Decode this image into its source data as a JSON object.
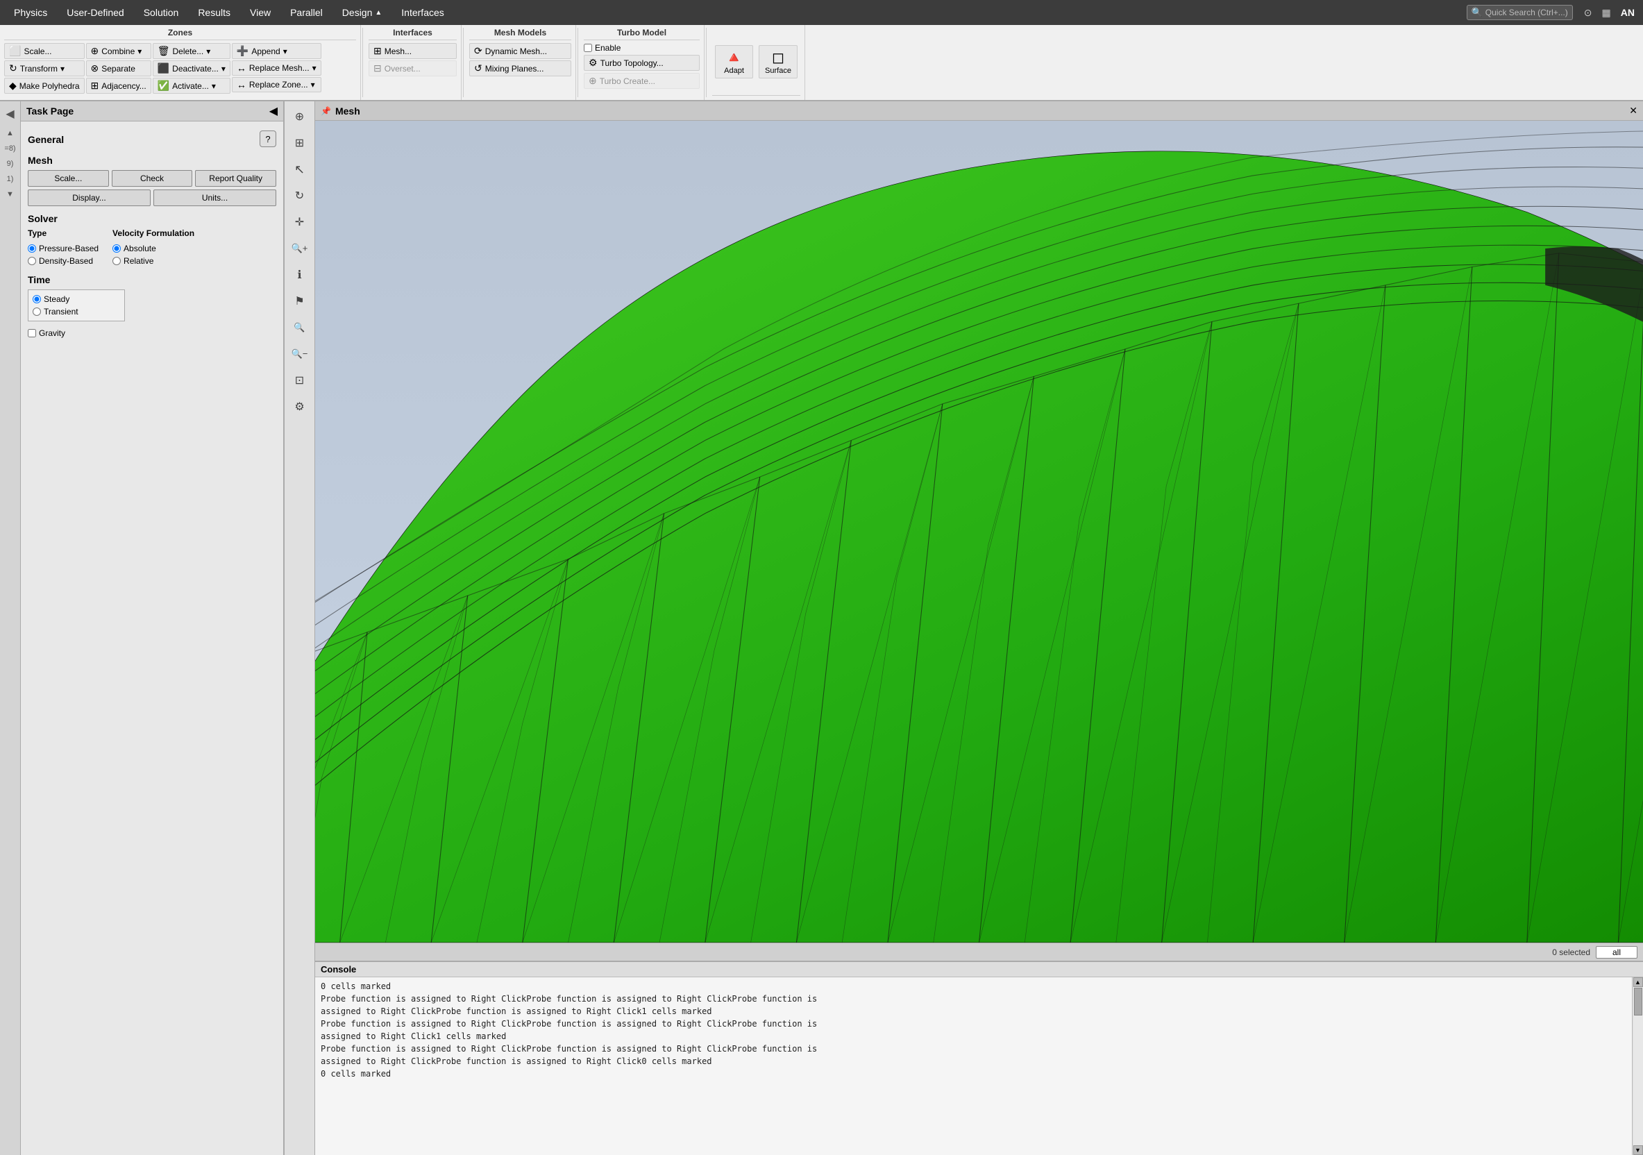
{
  "menu": {
    "items": [
      {
        "label": "Physics",
        "id": "physics"
      },
      {
        "label": "User-Defined",
        "id": "user-defined"
      },
      {
        "label": "Solution",
        "id": "solution"
      },
      {
        "label": "Results",
        "id": "results"
      },
      {
        "label": "View",
        "id": "view"
      },
      {
        "label": "Parallel",
        "id": "parallel"
      },
      {
        "label": "Design",
        "id": "design"
      },
      {
        "label": "Interfaces",
        "id": "interfaces"
      }
    ],
    "search_placeholder": "Quick Search (Ctrl+...)",
    "icons": [
      "⊙",
      "▦",
      "AN"
    ]
  },
  "ribbon": {
    "zones_title": "Zones",
    "zones_buttons": [
      {
        "label": "Scale...",
        "icon": "⬜"
      },
      {
        "label": "Transform",
        "icon": "↻"
      },
      {
        "label": "Make Polyhedra",
        "icon": "◆"
      }
    ],
    "zones_col2": [
      {
        "label": "Combine",
        "icon": "⊕"
      },
      {
        "label": "Separate",
        "icon": "⊗"
      },
      {
        "label": "Adjacency...",
        "icon": "⊞"
      }
    ],
    "zones_col3": [
      {
        "label": "Delete...",
        "icon": "🗑"
      },
      {
        "label": "Deactivate...",
        "icon": "⬛"
      },
      {
        "label": "Activate...",
        "icon": "✅"
      }
    ],
    "zones_col4": [
      {
        "label": "Append",
        "icon": "➕"
      },
      {
        "label": "Replace Mesh...",
        "icon": "↔"
      },
      {
        "label": "Replace Zone...",
        "icon": "↔"
      }
    ],
    "interfaces_title": "Interfaces",
    "interfaces_buttons": [
      {
        "label": "Mesh...",
        "icon": "⊞"
      },
      {
        "label": "Overset...",
        "icon": "⊟",
        "disabled": true
      }
    ],
    "mesh_models_title": "Mesh Models",
    "mesh_models_buttons": [
      {
        "label": "Dynamic Mesh...",
        "icon": "⟳"
      },
      {
        "label": "Mixing Planes...",
        "icon": "↺"
      }
    ],
    "turbo_model_title": "Turbo Model",
    "turbo_model_enable": "Enable",
    "turbo_buttons": [
      {
        "label": "Turbo Topology...",
        "icon": "⚙"
      },
      {
        "label": "Turbo Create...",
        "icon": "⊕",
        "disabled": true
      }
    ],
    "adapt_label": "Adapt",
    "surface_label": "Surface"
  },
  "task_panel": {
    "title": "Task Page",
    "close_arrow": "◀",
    "general_title": "General",
    "help_icon": "?",
    "mesh_title": "Mesh",
    "mesh_buttons_row1": [
      {
        "label": "Scale..."
      },
      {
        "label": "Check"
      },
      {
        "label": "Report Quality"
      }
    ],
    "mesh_buttons_row2": [
      {
        "label": "Display..."
      },
      {
        "label": "Units..."
      }
    ],
    "solver_title": "Solver",
    "type_title": "Type",
    "type_options": [
      {
        "label": "Pressure-Based",
        "checked": true
      },
      {
        "label": "Density-Based",
        "checked": false
      }
    ],
    "velocity_title": "Velocity Formulation",
    "velocity_options": [
      {
        "label": "Absolute",
        "checked": true
      },
      {
        "label": "Relative",
        "checked": false
      }
    ],
    "time_title": "Time",
    "time_options": [
      {
        "label": "Steady",
        "checked": true
      },
      {
        "label": "Transient",
        "checked": false
      }
    ],
    "gravity_label": "Gravity"
  },
  "toolbar": {
    "buttons": [
      {
        "icon": "⊕",
        "name": "zones-icon"
      },
      {
        "icon": "⊞",
        "name": "grid-icon"
      },
      {
        "icon": "↖",
        "name": "select-icon"
      },
      {
        "icon": "↻",
        "name": "rotate-icon"
      },
      {
        "icon": "✛",
        "name": "translate-icon"
      },
      {
        "icon": "🔍+",
        "name": "zoom-in-icon"
      },
      {
        "icon": "ℹ",
        "name": "info-icon"
      },
      {
        "icon": "⚑",
        "name": "flag-icon"
      },
      {
        "icon": "🔍",
        "name": "fit-icon"
      },
      {
        "icon": "🔍-",
        "name": "zoom-out-icon"
      },
      {
        "icon": "⊡",
        "name": "zoom-box-icon"
      },
      {
        "icon": "⚙",
        "name": "settings-icon"
      }
    ]
  },
  "viewport": {
    "title": "Mesh",
    "pin_icon": "📌",
    "close_icon": "✕",
    "footer_status": "0 selected",
    "footer_input": "all"
  },
  "console": {
    "title": "Console",
    "lines": [
      "0 cells marked",
      "Probe function is assigned to Right ClickProbe function is assigned to Right ClickProbe function is",
      "assigned to Right ClickProbe function is assigned to Right Click1 cells marked",
      "Probe function is assigned to Right ClickProbe function is assigned to Right ClickProbe function is",
      "assigned to Right Click1 cells marked",
      "Probe function is assigned to Right ClickProbe function is assigned to Right ClickProbe function is",
      "assigned to Right ClickProbe function is assigned to Right Click0 cells marked",
      "0 cells marked"
    ]
  },
  "left_strip": {
    "items": [
      {
        "label": "◀",
        "name": "collapse-arrow"
      },
      {
        "label": "◀",
        "name": "collapse-arrow2"
      },
      {
        "label": "▲",
        "name": "scroll-up"
      },
      {
        "label": "=8)",
        "name": "label-8"
      },
      {
        "label": "9)",
        "name": "label-9"
      },
      {
        "label": "1)",
        "name": "label-1"
      },
      {
        "label": "▼",
        "name": "scroll-down"
      }
    ]
  }
}
